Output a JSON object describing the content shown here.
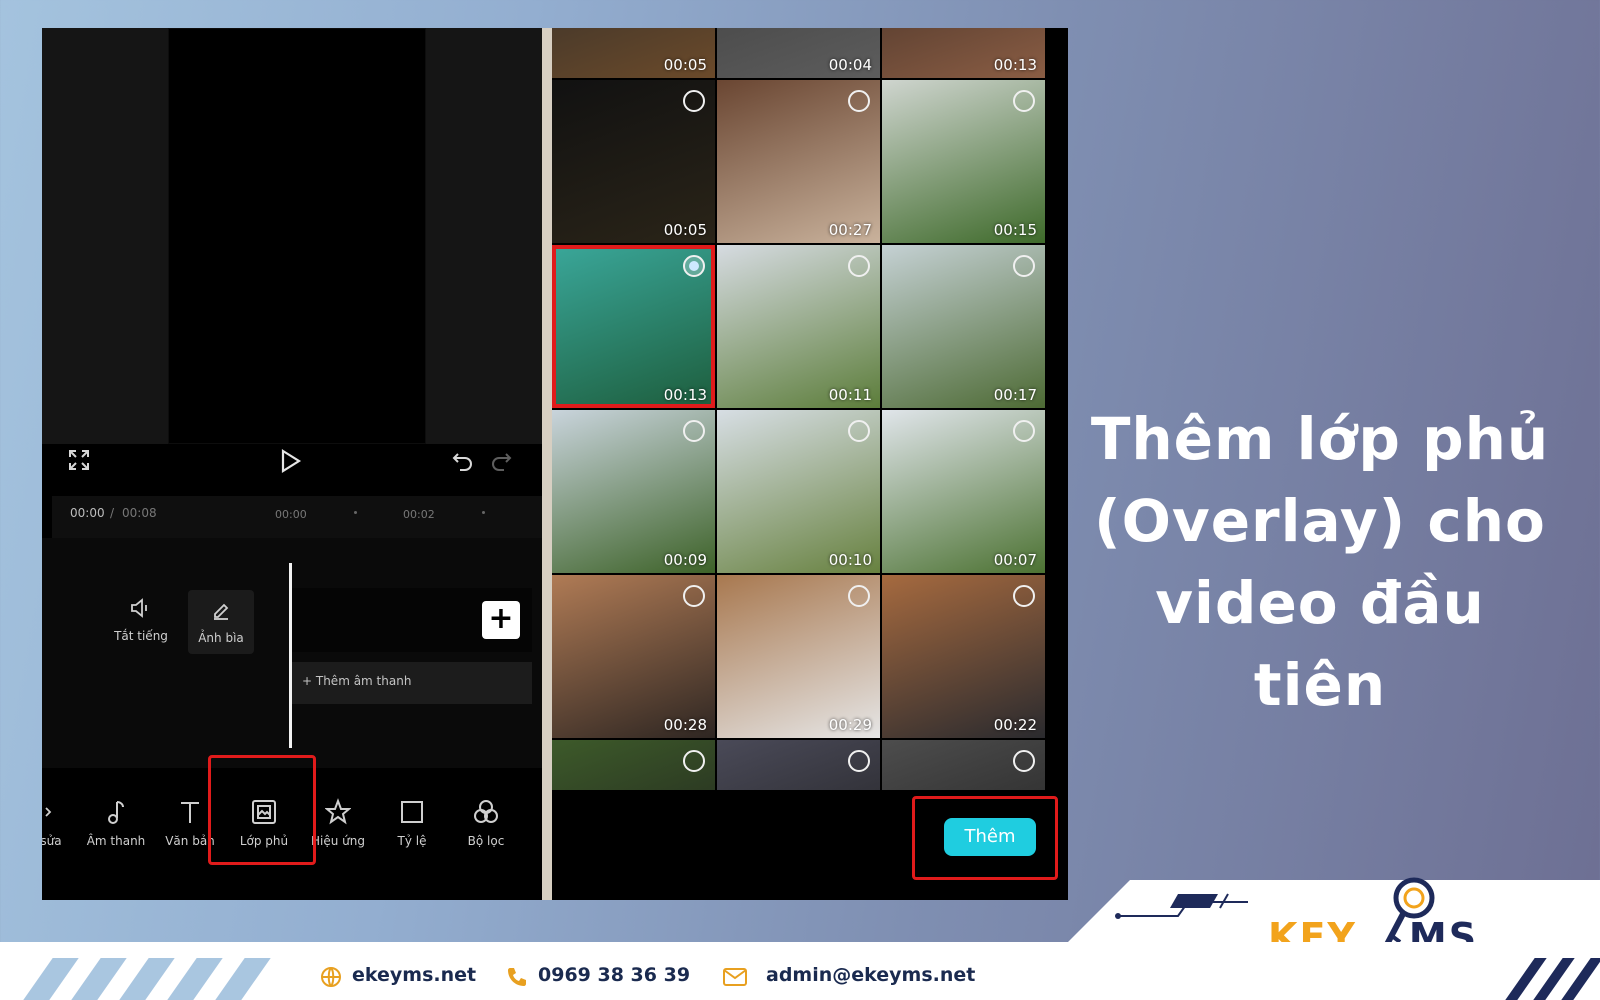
{
  "headline": [
    "Thêm lớp phủ",
    "(Overlay) cho",
    "video đầu tiên"
  ],
  "editor": {
    "time_current": "00:00",
    "time_separator": "/",
    "time_total": "00:08",
    "ticks": [
      "00:00",
      "00:02"
    ],
    "mute_label": "Tắt tiếng",
    "cover_label": "Ảnh bìa",
    "add_audio_label": "+ Thêm âm thanh",
    "add_clip_symbol": "+",
    "toolbar": [
      {
        "label": "sửa",
        "icon": "scissors-icon"
      },
      {
        "label": "Âm thanh",
        "icon": "music-note-icon"
      },
      {
        "label": "Văn bản",
        "icon": "text-icon"
      },
      {
        "label": "Lớp phủ",
        "icon": "overlay-icon"
      },
      {
        "label": "Hiệu ứng",
        "icon": "effects-star-icon"
      },
      {
        "label": "Tỷ lệ",
        "icon": "ratio-square-icon"
      },
      {
        "label": "Bộ lọc",
        "icon": "filter-icon"
      }
    ],
    "highlighted_tool": "Lớp phủ"
  },
  "picker": {
    "thumbnails": [
      {
        "duration": "00:05",
        "selected": false,
        "colors": [
          "#2b2b2b",
          "#6b4a2a"
        ]
      },
      {
        "duration": "00:04",
        "selected": false,
        "colors": [
          "#3c3c3c",
          "#5d5d5d"
        ]
      },
      {
        "duration": "00:13",
        "selected": false,
        "colors": [
          "#3a2a22",
          "#8a5d44"
        ]
      },
      {
        "duration": "00:05",
        "selected": false,
        "colors": [
          "#111111",
          "#2a2418"
        ]
      },
      {
        "duration": "00:27",
        "selected": false,
        "colors": [
          "#6a4632",
          "#c9b29c"
        ]
      },
      {
        "duration": "00:15",
        "selected": false,
        "colors": [
          "#cfd5cf",
          "#3e6a2a"
        ]
      },
      {
        "duration": "00:13",
        "selected": true,
        "colors": [
          "#3aa79a",
          "#1d5d3c"
        ]
      },
      {
        "duration": "00:11",
        "selected": false,
        "colors": [
          "#d6dbe1",
          "#5c7d3a"
        ]
      },
      {
        "duration": "00:17",
        "selected": false,
        "colors": [
          "#c5d1d4",
          "#4d6a34"
        ]
      },
      {
        "duration": "00:09",
        "selected": false,
        "colors": [
          "#c9d4dc",
          "#3d6228"
        ]
      },
      {
        "duration": "00:10",
        "selected": false,
        "colors": [
          "#d7dee4",
          "#67813f"
        ]
      },
      {
        "duration": "00:07",
        "selected": false,
        "colors": [
          "#e0e5ea",
          "#4c7232"
        ]
      },
      {
        "duration": "00:28",
        "selected": false,
        "colors": [
          "#b07b55",
          "#2e2622"
        ]
      },
      {
        "duration": "00:29",
        "selected": false,
        "colors": [
          "#a8784f",
          "#e6e6e6"
        ]
      },
      {
        "duration": "00:22",
        "selected": false,
        "colors": [
          "#a66a3f",
          "#2a2a2e"
        ]
      },
      {
        "duration": "",
        "selected": false,
        "colors": [
          "#3d5a2a",
          "#1b1b1b"
        ]
      },
      {
        "duration": "",
        "selected": false,
        "colors": [
          "#4a4a58",
          "#1b1b1b"
        ]
      },
      {
        "duration": "",
        "selected": false,
        "colors": [
          "#4d4d4d",
          "#1b1b1b"
        ]
      }
    ],
    "add_button_label": "Thêm"
  },
  "footer": {
    "website": "ekeyms.net",
    "phone": "0969 38 36 39",
    "email": "admin@ekeyms.net"
  },
  "logo": {
    "part1": "KEY",
    "part2": "MS"
  },
  "colors": {
    "highlight_red": "#e01b1b",
    "add_button": "#1fcde0",
    "logo_gold": "#f2a31c",
    "logo_navy": "#1e2a5a"
  }
}
